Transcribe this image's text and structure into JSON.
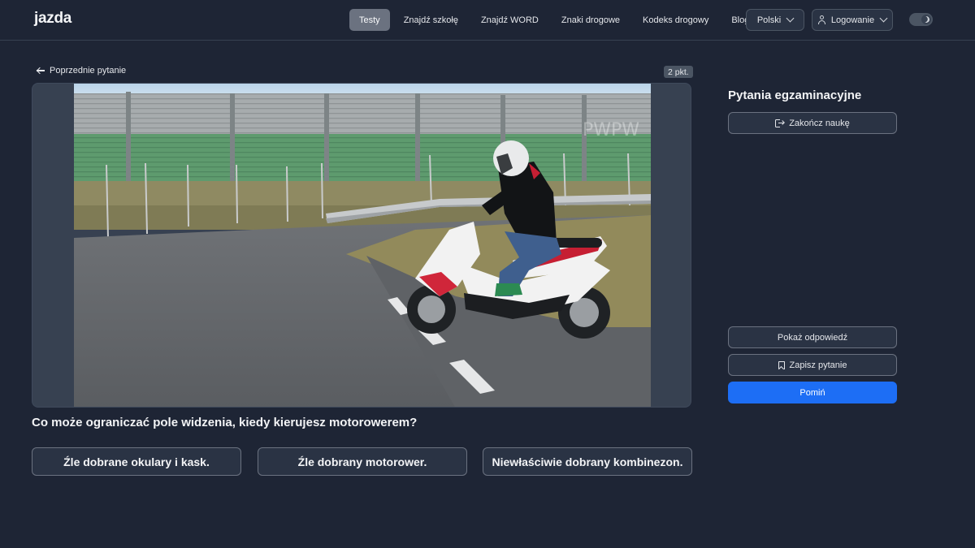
{
  "nav": {
    "logo": "jazda",
    "links": [
      "Testy",
      "Znajdź szkołę",
      "Znajdź WORD",
      "Znaki drogowe",
      "Kodeks drogowy",
      "Blog"
    ],
    "language": "Polski",
    "login": "Logowanie"
  },
  "question": {
    "prev_label": "Poprzednie pytanie",
    "points": "2 pkt.",
    "text": "Co może ograniczać pole widzenia, kiedy kierujesz motorowerem?",
    "answers": [
      "Źle dobrane okulary i kask.",
      "Źle dobrany motorower.",
      "Niewłaściwie dobrany kombinezon."
    ],
    "image_watermark": "PWPW"
  },
  "sidebar": {
    "title": "Pytania egzaminacyjne",
    "finish": "Zakończ naukę",
    "show_answer": "Pokaż odpowiedź",
    "save_question": "Zapisz pytanie",
    "skip": "Pomiń"
  },
  "colors": {
    "background": "#1e2535",
    "primary": "#1d6ef5",
    "accent": "#3b82f6"
  }
}
